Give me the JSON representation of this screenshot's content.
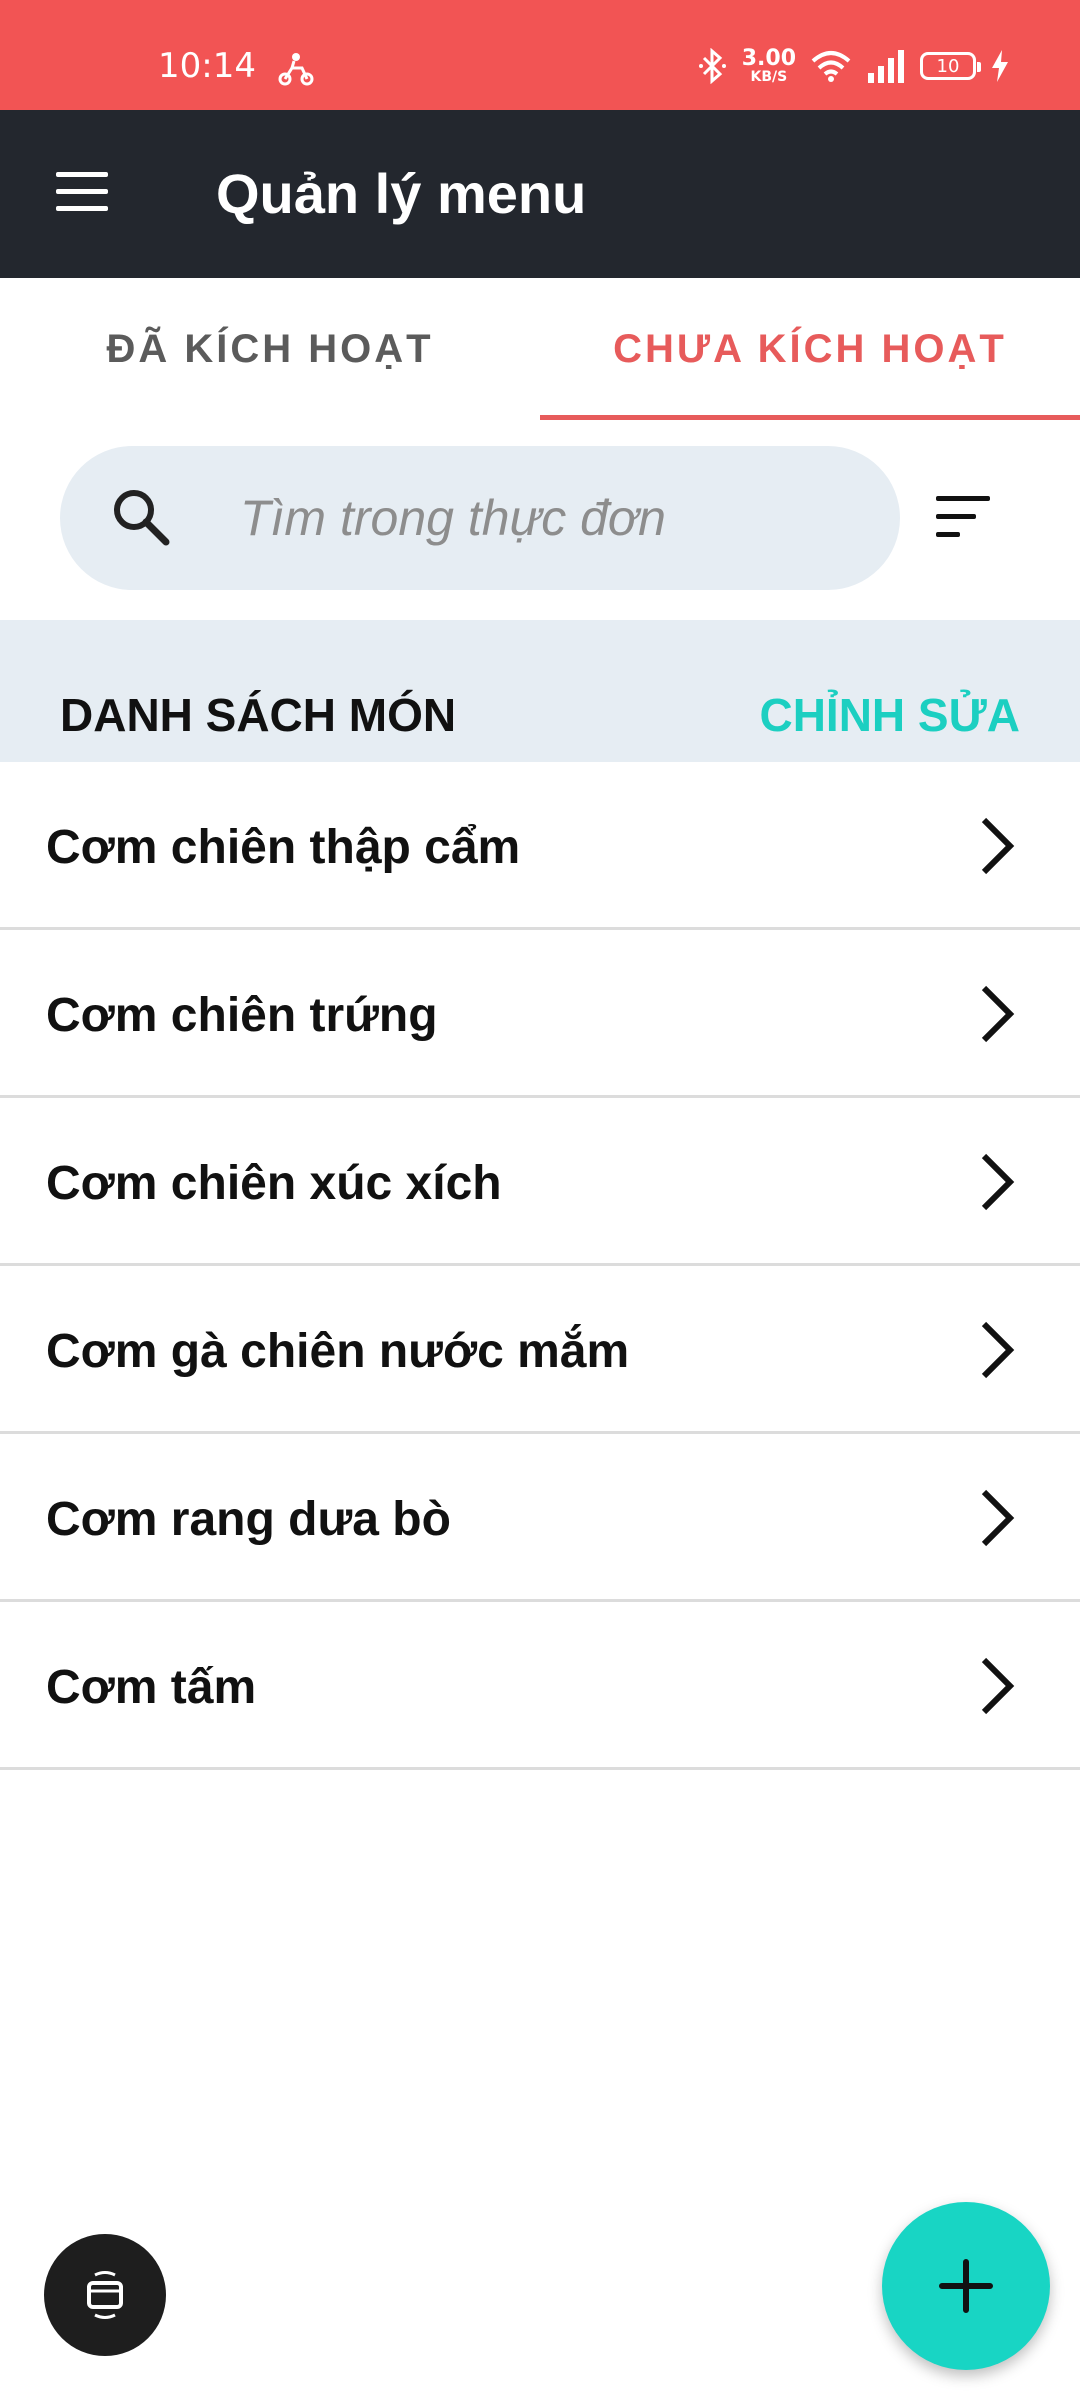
{
  "status_bar": {
    "time": "10:14",
    "net_speed_value": "3.00",
    "net_speed_unit": "KB/S",
    "battery": "10",
    "icons": [
      "delivery-scooter-icon",
      "bluetooth-icon",
      "wifi-icon",
      "signal-icon",
      "battery-icon",
      "charging-icon"
    ]
  },
  "app_bar": {
    "title": "Quản lý menu",
    "menu_icon": "hamburger-icon"
  },
  "tabs": [
    {
      "label": "ĐÃ KÍCH HOẠT",
      "active": false
    },
    {
      "label": "CHƯA KÍCH HOẠT",
      "active": true
    }
  ],
  "search": {
    "placeholder": "Tìm trong thực đơn",
    "value": "",
    "icon": "search-icon",
    "filter_icon": "sort-filter-icon"
  },
  "section": {
    "title": "DANH SÁCH MÓN",
    "edit_label": "CHỈNH SỬA"
  },
  "items": [
    {
      "name": "Cơm chiên thập cẩm"
    },
    {
      "name": "Cơm chiên trứng"
    },
    {
      "name": "Cơm chiên xúc xích"
    },
    {
      "name": "Cơm gà chiên nước mắm"
    },
    {
      "name": "Cơm rang dưa bò"
    },
    {
      "name": "Cơm tấm"
    }
  ],
  "fabs": {
    "left_icon": "screen-switch-icon",
    "right_icon": "plus-icon"
  },
  "colors": {
    "status_bar": "#f25454",
    "app_bar": "#23272e",
    "tab_active": "#e75b5b",
    "accent": "#18d5c4",
    "search_bg": "#e6edf3"
  }
}
